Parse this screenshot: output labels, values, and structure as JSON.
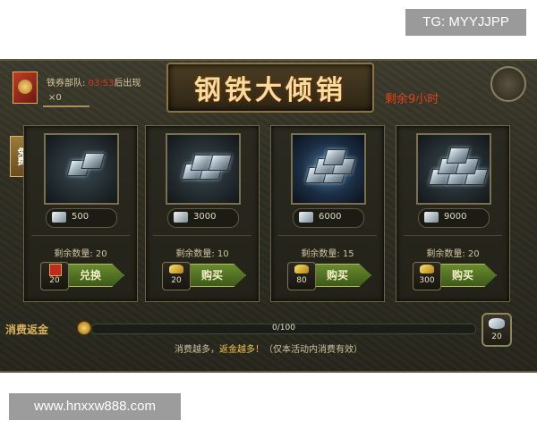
{
  "watermarks": {
    "top": "TG: MYYJJPP",
    "bottom": "www.hnxxw888.com"
  },
  "header": {
    "voucher_label": "铁券部队:",
    "voucher_timer": "03:53",
    "voucher_suffix": "后出现",
    "voucher_count": "×0",
    "title": "钢铁大倾销",
    "remaining": "剩余9小时"
  },
  "free_tag": "免费",
  "cards": [
    {
      "price": "500",
      "stock_label": "剩余数量: 20",
      "cost": "20",
      "cost_icon": "red-envelope",
      "button": "兑换",
      "ingots": 2
    },
    {
      "price": "3000",
      "stock_label": "剩余数量: 10",
      "cost": "20",
      "cost_icon": "gold-ingot",
      "button": "购买",
      "ingots": 4
    },
    {
      "price": "6000",
      "stock_label": "剩余数量: 15",
      "cost": "80",
      "cost_icon": "gold-ingot",
      "button": "购买",
      "ingots": 5
    },
    {
      "price": "9000",
      "stock_label": "剩余数量: 20",
      "cost": "300",
      "cost_icon": "gold-ingot",
      "button": "购买",
      "ingots": 6
    }
  ],
  "rebate": {
    "label": "消费返金",
    "progress_text": "0/100",
    "progress_fraction": 0,
    "reward_value": "20",
    "hint_part1": "消费越多，",
    "hint_highlight": "返金越多！",
    "hint_part2": "（仅本活动内消费有效）"
  },
  "colors": {
    "accent_gold": "#f6dca0",
    "timer_red": "#e0331f",
    "button_green": "#6a8a2f"
  }
}
